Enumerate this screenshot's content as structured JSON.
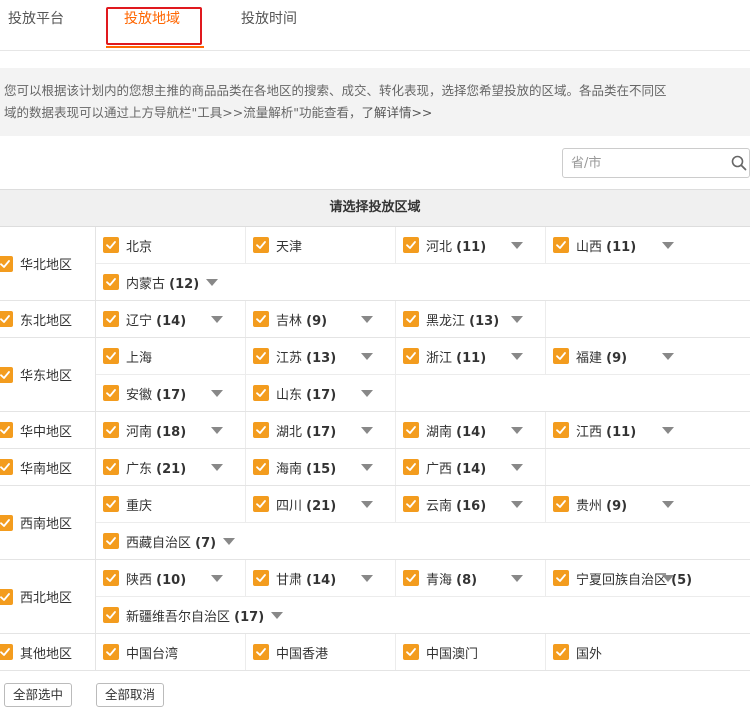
{
  "tabs": [
    {
      "label": "投放平台",
      "active": false
    },
    {
      "label": "投放地域",
      "active": true
    },
    {
      "label": "投放时间",
      "active": false
    }
  ],
  "info": {
    "text_line1": "您可以根据该计划内的您想主推的商品品类在各地区的搜索、成交、转化表现，选择您希望投放的区域。各品类在不同区",
    "text_line2": "域的数据表现可以通过上方导航栏\"工具>>流量解析\"功能查看，",
    "link": "了解详情>>"
  },
  "search": {
    "placeholder": "省/市",
    "value": "",
    "icon": "search-icon"
  },
  "table_title": "请选择投放区域",
  "regions": [
    {
      "name": "华北地区",
      "lines": [
        [
          {
            "p": "北京",
            "c": ""
          },
          {
            "p": "天津",
            "c": ""
          },
          {
            "p": "河北",
            "c": "(11)"
          },
          {
            "p": "山西",
            "c": "(11)"
          }
        ],
        [
          {
            "p": "内蒙古",
            "c": "(12)"
          }
        ]
      ]
    },
    {
      "name": "东北地区",
      "lines": [
        [
          {
            "p": "辽宁",
            "c": "(14)"
          },
          {
            "p": "吉林",
            "c": "(9)"
          },
          {
            "p": "黑龙江",
            "c": "(13)"
          }
        ]
      ]
    },
    {
      "name": "华东地区",
      "lines": [
        [
          {
            "p": "上海",
            "c": ""
          },
          {
            "p": "江苏",
            "c": "(13)"
          },
          {
            "p": "浙江",
            "c": "(11)"
          },
          {
            "p": "福建",
            "c": "(9)"
          }
        ],
        [
          {
            "p": "安徽",
            "c": "(17)"
          },
          {
            "p": "山东",
            "c": "(17)"
          }
        ]
      ]
    },
    {
      "name": "华中地区",
      "lines": [
        [
          {
            "p": "河南",
            "c": "(18)"
          },
          {
            "p": "湖北",
            "c": "(17)"
          },
          {
            "p": "湖南",
            "c": "(14)"
          },
          {
            "p": "江西",
            "c": "(11)"
          }
        ]
      ]
    },
    {
      "name": "华南地区",
      "lines": [
        [
          {
            "p": "广东",
            "c": "(21)"
          },
          {
            "p": "海南",
            "c": "(15)"
          },
          {
            "p": "广西",
            "c": "(14)"
          }
        ]
      ]
    },
    {
      "name": "西南地区",
      "lines": [
        [
          {
            "p": "重庆",
            "c": ""
          },
          {
            "p": "四川",
            "c": "(21)"
          },
          {
            "p": "云南",
            "c": "(16)"
          },
          {
            "p": "贵州",
            "c": "(9)"
          }
        ],
        [
          {
            "p": "西藏自治区",
            "c": "(7)"
          }
        ]
      ]
    },
    {
      "name": "西北地区",
      "lines": [
        [
          {
            "p": "陕西",
            "c": "(10)"
          },
          {
            "p": "甘肃",
            "c": "(14)"
          },
          {
            "p": "青海",
            "c": "(8)"
          },
          {
            "p": "宁夏回族自治区",
            "c": "(5)"
          }
        ],
        [
          {
            "p": "新疆维吾尔自治区",
            "c": "(17)"
          }
        ]
      ]
    },
    {
      "name": "其他地区",
      "lines": [
        [
          {
            "p": "中国台湾",
            "c": ""
          },
          {
            "p": "中国香港",
            "c": ""
          },
          {
            "p": "中国澳门",
            "c": ""
          },
          {
            "p": "国外",
            "c": ""
          }
        ]
      ]
    }
  ],
  "buttons": {
    "select_all": "全部选中",
    "cancel_all": "全部取消"
  },
  "colors": {
    "accent": "#ff6600",
    "checkbox": "#f39c1e",
    "highlight_box": "#e0191e"
  }
}
